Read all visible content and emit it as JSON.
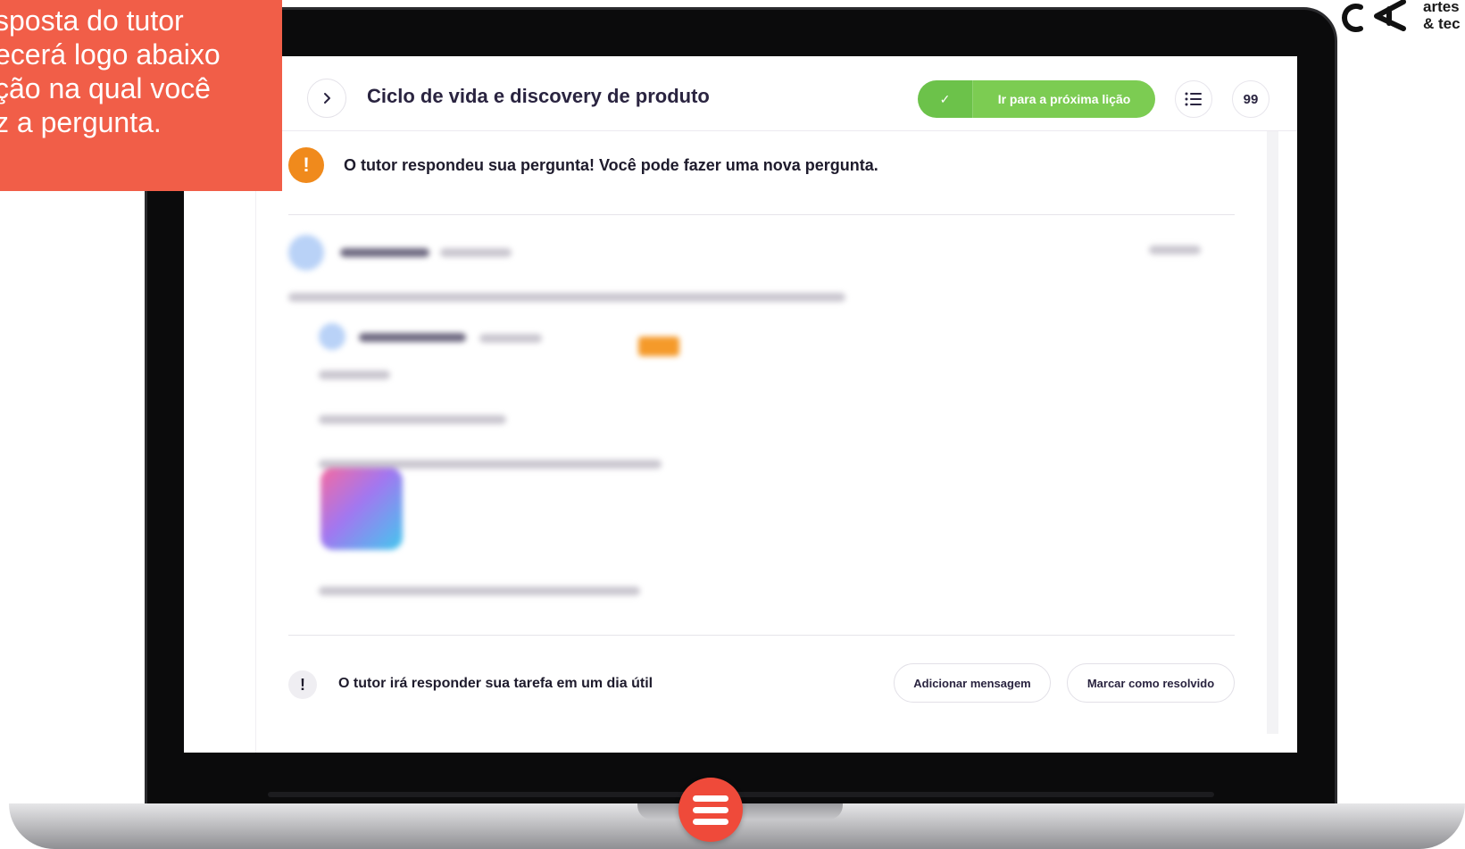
{
  "callout": {
    "lines": [
      "sposta do tutor",
      "ecerá logo abaixo",
      "ção na qual você",
      "z a pergunta."
    ]
  },
  "logo": {
    "line1": "artes",
    "line2": "& tec"
  },
  "lesson": {
    "title": "Ciclo de vida e discovery de produto",
    "next_label": "Ir para a próxima lição",
    "check_glyph": "✓",
    "quote_glyph": "99"
  },
  "notice": {
    "icon_glyph": "!",
    "text": "O tutor respondeu sua pergunta! Você pode fazer uma nova pergunta."
  },
  "footer": {
    "icon_glyph": "!",
    "text": "O tutor irá responder sua tarefa em um dia útil",
    "add_message_label": "Adicionar mensagem",
    "mark_resolved_label": "Marcar como resolvido"
  },
  "colors": {
    "callout_bg": "#f15e48",
    "next_button_green": "#7ccc52",
    "notice_orange": "#f08a1c",
    "tag_orange": "#f59a2a",
    "fab_red": "#ef4a3a"
  },
  "icons": [
    "chevron-right-icon",
    "check-icon",
    "list-icon",
    "quote-icon",
    "alert-icon",
    "menu-icon"
  ]
}
